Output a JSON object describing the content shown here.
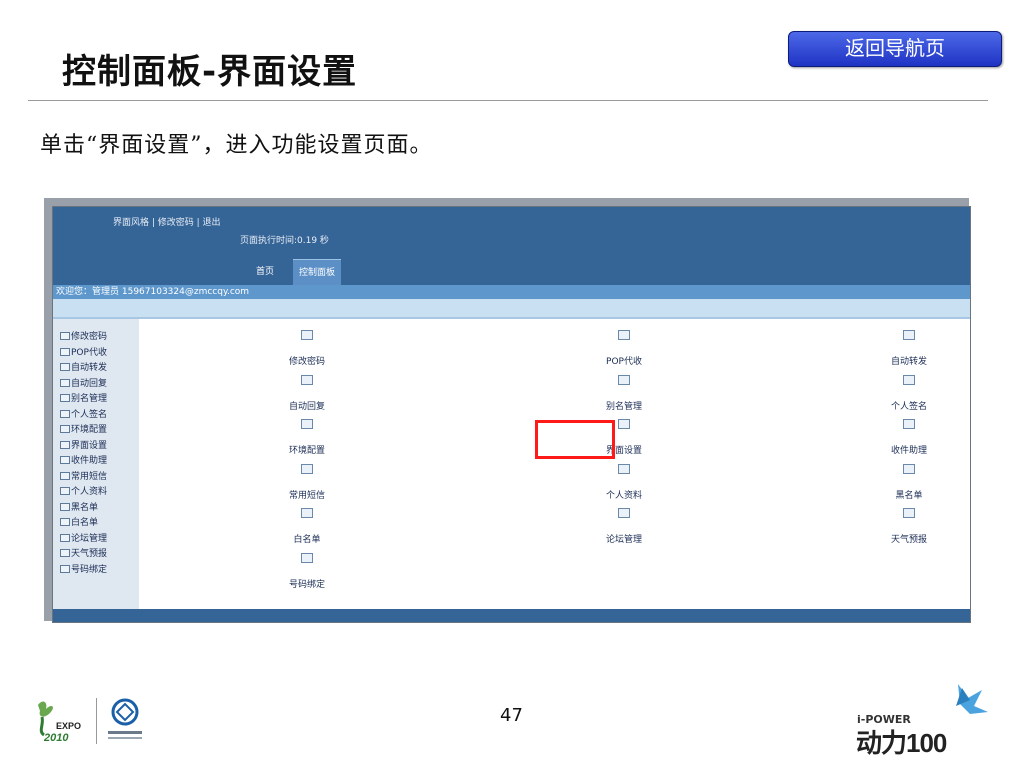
{
  "slide": {
    "title": "控制面板-界面设置",
    "back_button": "返回导航页",
    "intro": "单击“界面设置”，进入功能设置页面。",
    "page_number": "47"
  },
  "app": {
    "header_links": "界面风格 | 修改密码 | 退出",
    "exec_time": "页面执行时间:0.19 秒",
    "tabs": [
      "首页",
      "控制面板"
    ],
    "active_tab": "控制面板",
    "welcome": "欢迎您：管理员 15967103324@zmccqy.com",
    "sidebar": [
      "修改密码",
      "POP代收",
      "自动转发",
      "自动回复",
      "别名管理",
      "个人签名",
      "环境配置",
      "界面设置",
      "收件助理",
      "常用短信",
      "个人资料",
      "黑名单",
      "白名单",
      "论坛管理",
      "天气预报",
      "号码绑定"
    ],
    "grid": [
      [
        "修改密码",
        "POP代收",
        "自动转发"
      ],
      [
        "自动回复",
        "别名管理",
        "个人签名"
      ],
      [
        "环境配置",
        "界面设置",
        "收件助理"
      ],
      [
        "常用短信",
        "个人资料",
        "黑名单"
      ],
      [
        "白名单",
        "论坛管理",
        "天气预报"
      ],
      [
        "号码绑定"
      ]
    ],
    "highlighted": "界面设置",
    "colors": {
      "header": "#356497",
      "highlight": "#ff1a1a",
      "sidebar": "#dfe7f0"
    }
  },
  "logos": {
    "expo_text": "EXPO",
    "expo_year": "2010",
    "ipower_top": "i-POWER",
    "ipower_main": "动力100"
  }
}
